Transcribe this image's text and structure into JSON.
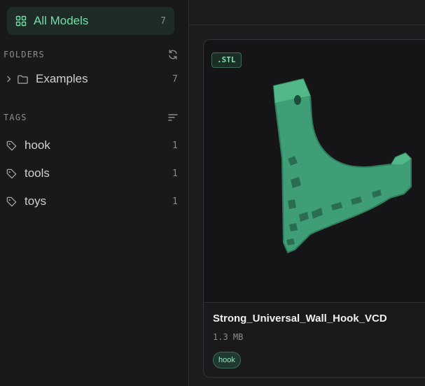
{
  "colors": {
    "accent": "#6ee0a8",
    "model_green": "#3f9e75"
  },
  "sidebar": {
    "all_models": {
      "label": "All Models",
      "count": "7",
      "icon": "grid-icon"
    },
    "folders": {
      "title": "FOLDERS",
      "action_icon": "refresh-icon",
      "items": [
        {
          "label": "Examples",
          "count": "7",
          "icon": "folder-icon"
        }
      ]
    },
    "tags": {
      "title": "TAGS",
      "action_icon": "sort-icon",
      "items": [
        {
          "label": "hook",
          "count": "1",
          "icon": "tag-icon"
        },
        {
          "label": "tools",
          "count": "1",
          "icon": "tag-icon"
        },
        {
          "label": "toys",
          "count": "1",
          "icon": "tag-icon"
        }
      ]
    }
  },
  "main": {
    "cards": [
      {
        "format": ".STL",
        "title": "Strong_Universal_Wall_Hook_VCD",
        "size": "1.3 MB",
        "tags": [
          "hook"
        ]
      }
    ]
  }
}
